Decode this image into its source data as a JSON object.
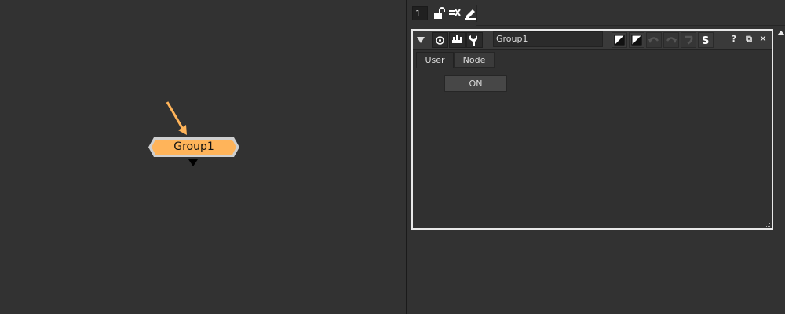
{
  "node_graph": {
    "group_node": {
      "label": "Group1",
      "fill_color": "#ffb45a",
      "border_color": "#cfcfcf",
      "arrow_color": "#ffb45a"
    }
  },
  "properties_bin": {
    "max_panels_value": "1",
    "toolbar_icons": [
      "lock-icon",
      "clear-panels-icon",
      "edit-pencil-icon"
    ],
    "panel": {
      "node_name": "Group1",
      "header_icons": [
        "collapse-arrow-icon",
        "center-node-icon",
        "jump-to-input-icon",
        "wrench-icon"
      ],
      "swatch_icons": [
        "node-color-swatch-icon",
        "font-color-swatch-icon",
        "undo-icon",
        "redo-icon",
        "revert-icon",
        "script-s-icon"
      ],
      "window_controls": {
        "help": "?",
        "float": "⧉",
        "close": "✕"
      },
      "tabs": [
        {
          "label": "User",
          "active": true
        },
        {
          "label": "Node",
          "active": false
        }
      ],
      "on_button_label": "ON"
    }
  }
}
